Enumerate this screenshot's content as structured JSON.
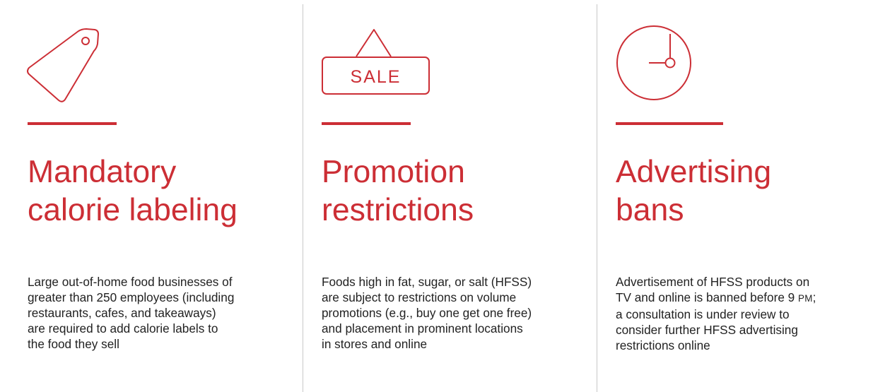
{
  "colors": {
    "accent": "#cc2e35",
    "divider": "#c8c8c8",
    "text": "#222222"
  },
  "columns": [
    {
      "icon": "price-tag-icon",
      "title_lines": [
        "Mandatory",
        "calorie labeling"
      ],
      "body_lines": [
        "Large out-of-home food businesses of",
        "greater than 250 employees (including",
        "restaurants, cafes, and takeaways)",
        "are required to add calorie labels to",
        "the food they sell"
      ]
    },
    {
      "icon": "sale-sign-icon",
      "icon_text": "SALE",
      "title_lines": [
        "Promotion",
        "restrictions"
      ],
      "body_lines": [
        "Foods high in fat, sugar, or salt (HFSS)",
        "are subject to restrictions on volume",
        "promotions (e.g., buy one get one free)",
        "and placement in prominent locations",
        "in stores and online"
      ]
    },
    {
      "icon": "clock-icon",
      "title_lines": [
        "Advertising",
        "bans"
      ],
      "body_lines": [
        "Advertisement of HFSS products on",
        "TV and online is banned before 9",
        "a consultation is under review to",
        "consider further HFSS advertising",
        "restrictions online"
      ],
      "time_suffix": "PM",
      "time_punct": ";"
    }
  ]
}
